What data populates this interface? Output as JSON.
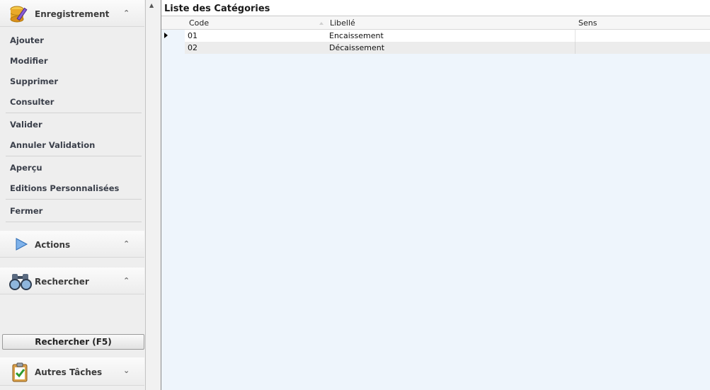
{
  "sidebar": {
    "enregistrement": {
      "title": "Enregistrement",
      "icon": "database-pencil-icon",
      "items": [
        {
          "label": "Ajouter"
        },
        {
          "label": "Modifier"
        },
        {
          "label": "Supprimer"
        },
        {
          "label": "Consulter"
        },
        {
          "label": "Valider"
        },
        {
          "label": "Annuler Validation"
        },
        {
          "label": "Aperçu"
        },
        {
          "label": "Editions Personnalisées"
        },
        {
          "label": "Fermer"
        }
      ]
    },
    "actions": {
      "title": "Actions",
      "icon": "play-icon"
    },
    "rechercher": {
      "title": "Rechercher",
      "icon": "binoculars-icon",
      "button_label": "Rechercher (F5)"
    },
    "autres": {
      "title": "Autres Tâches",
      "icon": "clipboard-check-icon"
    }
  },
  "main": {
    "title": "Liste des Catégories",
    "columns": [
      "Code",
      "Libellé",
      "Sens"
    ],
    "rows": [
      {
        "code": "01",
        "libelle": "Encaissement",
        "sens": ""
      },
      {
        "code": "02",
        "libelle": "Décaissement",
        "sens": ""
      }
    ]
  }
}
